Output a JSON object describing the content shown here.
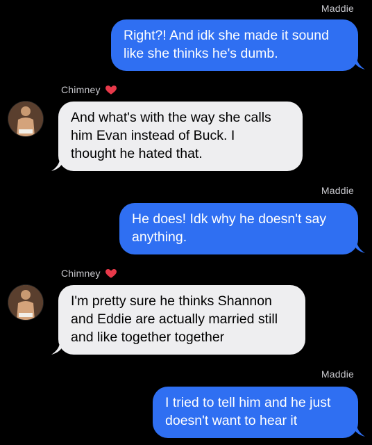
{
  "messages": [
    {
      "sender": "Maddie",
      "text_lines": [
        "Right?! And idk she made it sound",
        "like she thinks he's dumb."
      ]
    },
    {
      "sender": "Chimney",
      "text_lines": [
        "And what's with the way she calls",
        "him Evan instead of Buck. I",
        "thought he hated that."
      ]
    },
    {
      "sender": "Maddie",
      "text_lines": [
        "He does! Idk why he doesn't say",
        "anything."
      ]
    },
    {
      "sender": "Chimney",
      "text_lines": [
        "I'm pretty sure he thinks Shannon",
        "and Eddie are actually married still",
        "and like together together"
      ]
    },
    {
      "sender": "Maddie",
      "text_lines": [
        "I tried to tell him and he just",
        "doesn't want to hear it"
      ]
    }
  ],
  "colors": {
    "background": "#000000",
    "outgoing_bubble": "#2f6ff2",
    "incoming_bubble": "#eeeef0",
    "heart": "#e8394a"
  },
  "icons": [
    "heart-icon",
    "contact-avatar"
  ]
}
